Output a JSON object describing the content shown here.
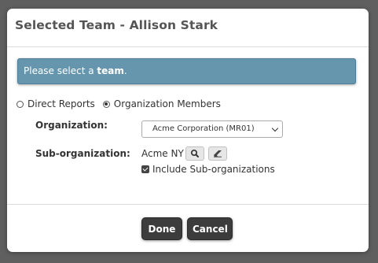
{
  "dialog": {
    "title": "Selected Team - Allison Stark"
  },
  "alert": {
    "prefix": "Please select a ",
    "emphasis": "team",
    "suffix": "."
  },
  "team_type": {
    "options": [
      {
        "label": "Direct Reports",
        "selected": false
      },
      {
        "label": "Organization Members",
        "selected": true
      }
    ]
  },
  "organization": {
    "label": "Organization:",
    "selected_value": "Acme Corporation (MR01)"
  },
  "sub_organization": {
    "label": "Sub-organization:",
    "value": "Acme NY",
    "search_icon": "search-icon",
    "clear_icon": "eraser-icon",
    "include_label": "Include Sub-organizations",
    "include_checked": true
  },
  "footer": {
    "done_label": "Done",
    "cancel_label": "Cancel"
  },
  "colors": {
    "overlay": "#5f5f5f",
    "alert_bg": "#6596ad",
    "button_bg": "#3c3c3c"
  }
}
